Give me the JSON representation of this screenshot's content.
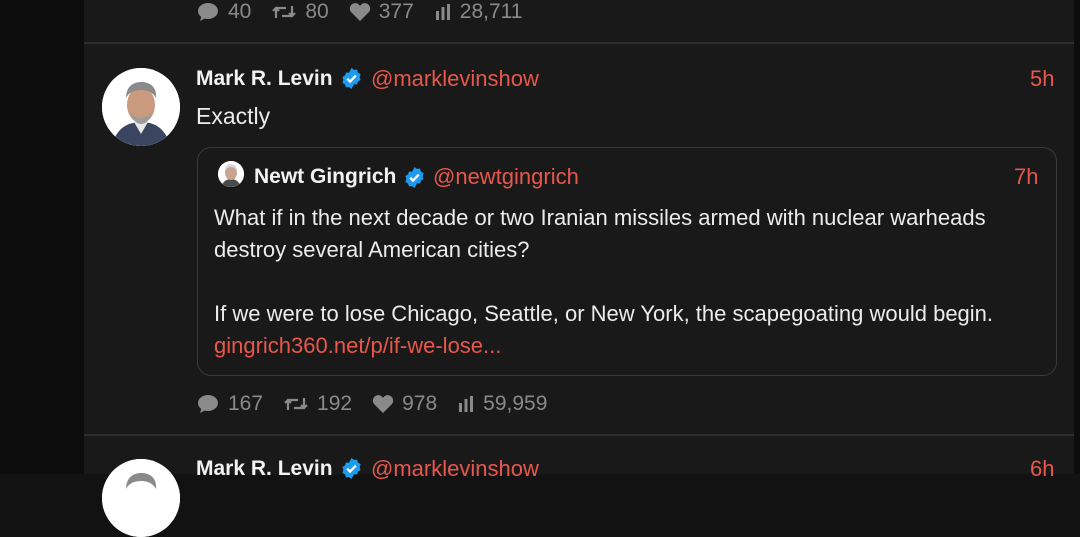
{
  "previous_tweet": {
    "stats": {
      "replies": "40",
      "retweets": "80",
      "likes": "377",
      "views": "28,711"
    }
  },
  "tweet": {
    "author_name": "Mark R. Levin",
    "handle": "@marklevinshow",
    "time": "5h",
    "text": "Exactly",
    "quoted": {
      "author_name": "Newt Gingrich",
      "handle": "@newtgingrich",
      "time": "7h",
      "paragraph1": "What if in the next decade or two Iranian missiles armed with nuclear warheads destroy several American cities?",
      "paragraph2": "If we were to lose Chicago, Seattle, or New York, the scapegoating would begin.",
      "link": "gingrich360.net/p/if-we-lose..."
    },
    "stats": {
      "replies": "167",
      "retweets": "192",
      "likes": "978",
      "views": "59,959"
    }
  },
  "next_tweet": {
    "author_name": "Mark R. Levin",
    "handle": "@marklevinshow",
    "time": "6h"
  },
  "colors": {
    "accent": "#e8574c",
    "verified": "#1d9bf0",
    "background": "#191919"
  }
}
